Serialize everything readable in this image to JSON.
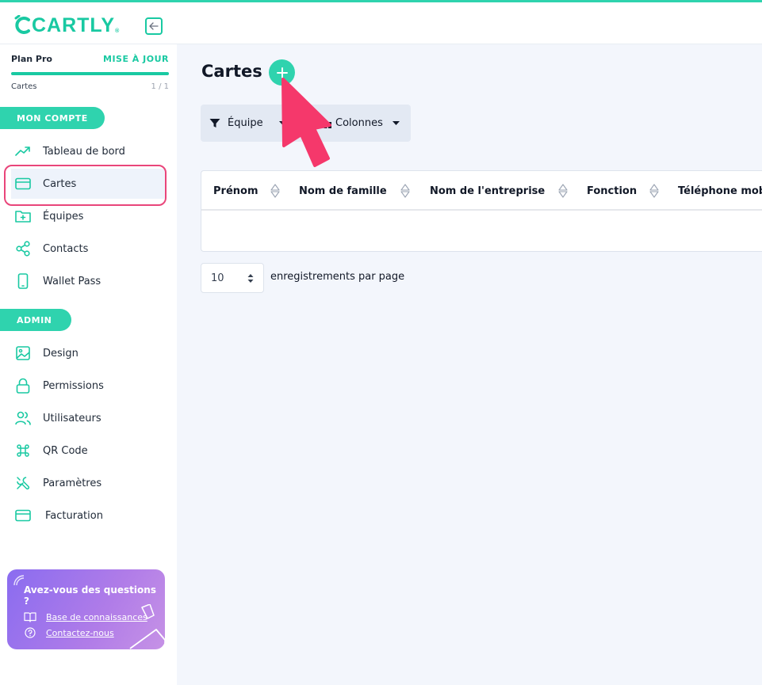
{
  "app": {
    "logo_text": "CARTLY",
    "brand_color": "#2fd3ae",
    "highlight_color": "#e9457a"
  },
  "sidebar": {
    "plan_label": "Plan Pro",
    "upgrade_label": "MISE À JOUR",
    "usage_label": "Cartes",
    "usage_count": "1 / 1",
    "usage_progress": 1.0,
    "section_account": "MON COMPTE",
    "account_items": [
      {
        "label": "Tableau de bord",
        "icon": "trending-up-icon"
      },
      {
        "label": "Cartes",
        "icon": "credit-card-icon",
        "active": true
      },
      {
        "label": "Équipes",
        "icon": "folder-plus-icon"
      },
      {
        "label": "Contacts",
        "icon": "share-icon"
      },
      {
        "label": "Wallet Pass",
        "icon": "smartphone-icon"
      }
    ],
    "section_admin": "ADMIN",
    "admin_items": [
      {
        "label": "Design",
        "icon": "image-icon"
      },
      {
        "label": "Permissions",
        "icon": "lock-icon"
      },
      {
        "label": "Utilisateurs",
        "icon": "users-icon"
      },
      {
        "label": "QR Code",
        "icon": "command-icon"
      },
      {
        "label": "Paramètres",
        "icon": "tools-icon"
      },
      {
        "label": "Facturation",
        "icon": "credit-card-icon"
      }
    ],
    "help": {
      "title": "Avez-vous des questions ?",
      "knowledge_link": "Base de connaissances",
      "contact_link": "Contactez-nous"
    }
  },
  "main": {
    "title": "Cartes",
    "toolbar": {
      "team_filter": "Équipe",
      "columns": "Colonnes"
    },
    "table": {
      "columns": [
        "Prénom",
        "Nom de famille",
        "Nom de l'entreprise",
        "Fonction",
        "Téléphone mobil"
      ]
    },
    "pagination": {
      "page_size": "10",
      "label": "enregistrements par page"
    }
  }
}
